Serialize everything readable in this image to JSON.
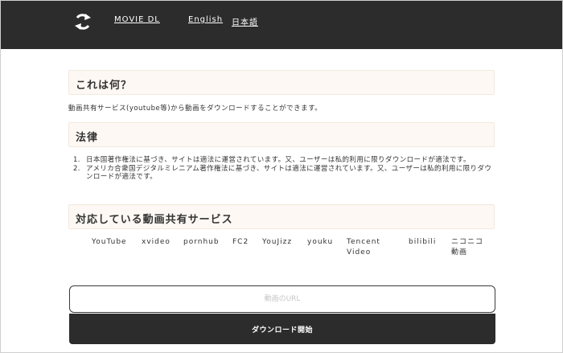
{
  "header": {
    "logo_icon": "sync-arrows-icon",
    "brand": "MOVIE DL",
    "lang_english": "English",
    "lang_japanese": "日本語"
  },
  "about": {
    "heading": "これは何？",
    "description": "動画共有サービス(youtube等)から動画をダウンロードすることができます。"
  },
  "law": {
    "heading": "法律",
    "items": [
      {
        "num": "1.",
        "text": "日本国著作権法に基づき、サイトは適法に運営されています。又、ユーザーは私的利用に限りダウンロードが適法です。"
      },
      {
        "num": "2.",
        "text": "アメリカ合衆国デジタルミレニアム著作権法に基づき、サイトは適法に運営されています。又、ユーザーは私的利用に限りダウンロードが適法です。"
      }
    ]
  },
  "services": {
    "heading": "対応している動画共有サービス",
    "items": [
      {
        "l1": "YouTube",
        "l2": ""
      },
      {
        "l1": "xvideo",
        "l2": ""
      },
      {
        "l1": "pornhub",
        "l2": ""
      },
      {
        "l1": "FC2",
        "l2": ""
      },
      {
        "l1": "YouJizz",
        "l2": ""
      },
      {
        "l1": "youku",
        "l2": ""
      },
      {
        "l1": "Tencent",
        "l2": "Video"
      },
      {
        "l1": "bilibili",
        "l2": ""
      },
      {
        "l1": "ニコニコ",
        "l2": "動画"
      }
    ]
  },
  "download": {
    "url_placeholder": "動画のURL",
    "url_value": "",
    "button_label": "ダウンロード開始"
  },
  "colors": {
    "header_bg": "#2c2c2c",
    "section_bg": "#fdf8f3",
    "button_bg": "#2c2c2c"
  }
}
